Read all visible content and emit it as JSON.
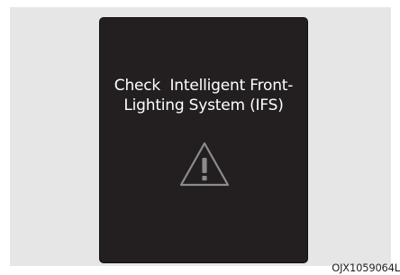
{
  "warning": {
    "message_line1": "Check  Intelligent Front-",
    "message_line2": "Lighting System (IFS)",
    "icon": "warning-triangle-icon",
    "icon_color": "#8c8c8c",
    "display_color": "#231f20",
    "text_color": "#ffffff"
  },
  "figure": {
    "code": "OJX1059064L"
  }
}
